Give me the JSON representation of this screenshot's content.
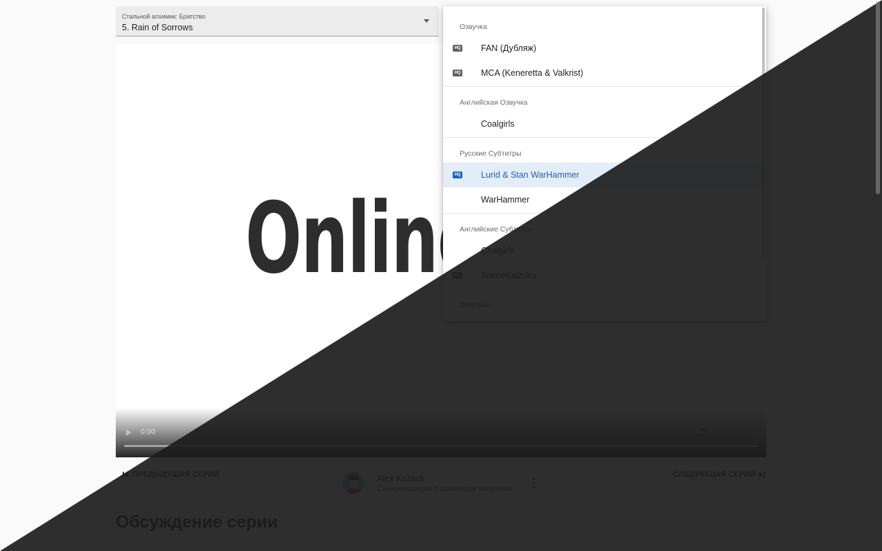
{
  "episode_select": {
    "label": "Стальной алхимик: Братство",
    "value": "5. Rain of Sorrows"
  },
  "video": {
    "logo_text": "Online",
    "time": "0:00"
  },
  "translations_menu": {
    "groups": [
      {
        "header": "Озвучка",
        "items": [
          {
            "label": "FAN (Дубляж)",
            "hq": true,
            "selected": false
          },
          {
            "label": "MCA (Keneretta & Valkrist)",
            "hq": true,
            "selected": false
          }
        ]
      },
      {
        "header": "Английская Озвучка",
        "items": [
          {
            "label": "Coalgirls",
            "hq": false,
            "selected": false
          }
        ]
      },
      {
        "header": "Русские Субтитры",
        "items": [
          {
            "label": "Lurid & Stan WarHammer",
            "hq": true,
            "selected": true
          },
          {
            "label": "WarHammer",
            "hq": false,
            "selected": false
          }
        ]
      },
      {
        "header": "Английские Субтитры",
        "items": [
          {
            "label": "Coalgirls",
            "hq": false,
            "selected": false
          },
          {
            "label": "AnimeKaizoku",
            "hq": true,
            "selected": false
          }
        ]
      },
      {
        "header": "Оригинал",
        "items": []
      }
    ],
    "hq_badge": "HQ",
    "accent_color": "#1565c0"
  },
  "navigation": {
    "prev_label": "ПРЕДЫДУЩАЯ СЕРИЯ",
    "next_label": "СЛЕДУЮЩАЯ СЕРИЯ"
  },
  "user": {
    "name": "Alex Kozack",
    "status": "Синхронизация с Шикимори включена"
  },
  "discussion": {
    "title": "Обсуждение серии"
  },
  "icons": {
    "play": "play-icon",
    "volume": "volume-icon",
    "fullscreen": "fullscreen-icon",
    "more": "more-vert-icon",
    "prev": "skip-previous-icon",
    "next": "skip-next-icon",
    "dropdown": "arrow-drop-down-icon"
  }
}
